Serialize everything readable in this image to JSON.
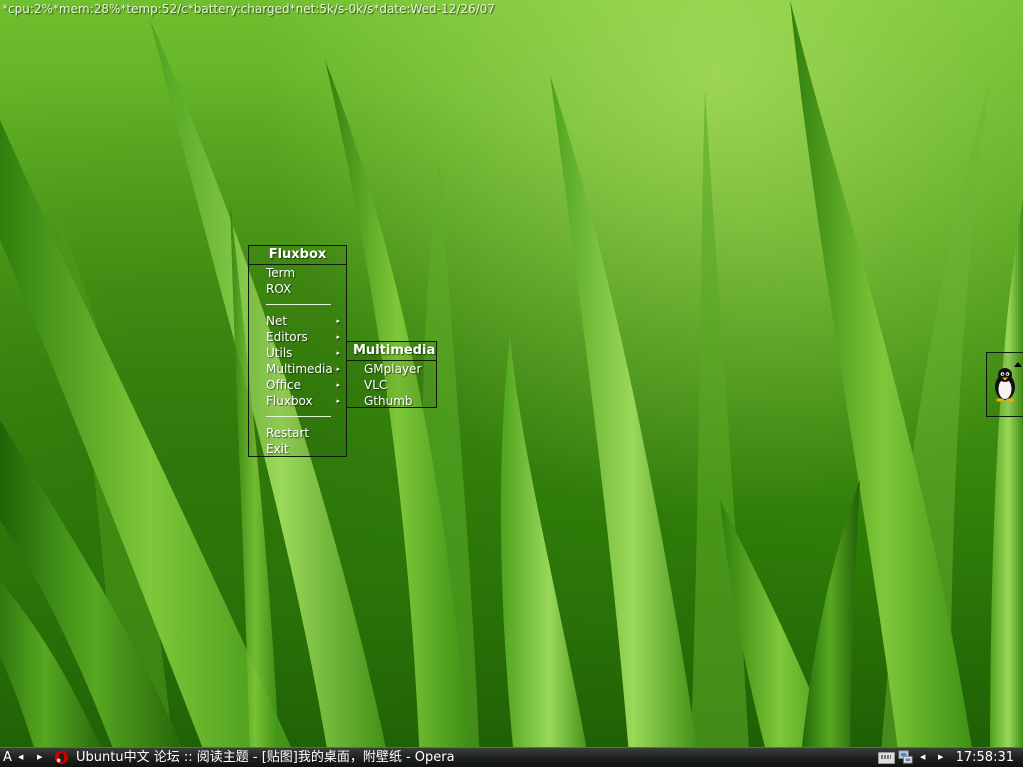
{
  "conky": {
    "text": "*cpu:2%*mem:28%*temp:52/c*battery:charged*net:5k/s-0k/s*date:Wed-12/26/07"
  },
  "root_menu": {
    "title": "Fluxbox",
    "items": [
      {
        "label": "Term",
        "submenu": false
      },
      {
        "label": "ROX",
        "submenu": false
      },
      {
        "separator": true
      },
      {
        "label": "Net",
        "submenu": true
      },
      {
        "label": "Editors",
        "submenu": true
      },
      {
        "label": "Utils",
        "submenu": true
      },
      {
        "label": "Multimedia",
        "submenu": true
      },
      {
        "label": "Office",
        "submenu": true
      },
      {
        "label": "Fluxbox",
        "submenu": true
      },
      {
        "separator": true
      },
      {
        "label": "Restart",
        "submenu": false
      },
      {
        "label": "Exit",
        "submenu": false
      }
    ]
  },
  "multimedia_menu": {
    "title": "Multimedia",
    "items": [
      "GMplayer",
      "VLC",
      "Gthumb"
    ]
  },
  "toolbar": {
    "workspace": "A",
    "prev_workspace_icon": "triangle-left-icon",
    "next_workspace_icon": "triangle-right-icon",
    "task_icon": "opera-icon",
    "task_title": "Ubuntu中文 论坛 :: 阅读主题 - [贴图]我的桌面，附壁纸 - Opera",
    "tray_icons": [
      "keyboard-icon",
      "network-icon"
    ],
    "clock": "17:58:31"
  },
  "slit": {
    "icon": "penguin-icon"
  },
  "colors": {
    "menu_border": "#0b1a02",
    "toolbar_bg": "#1c1f1c",
    "grass_light": "#8fd14a",
    "grass_dark": "#1e5c05"
  }
}
